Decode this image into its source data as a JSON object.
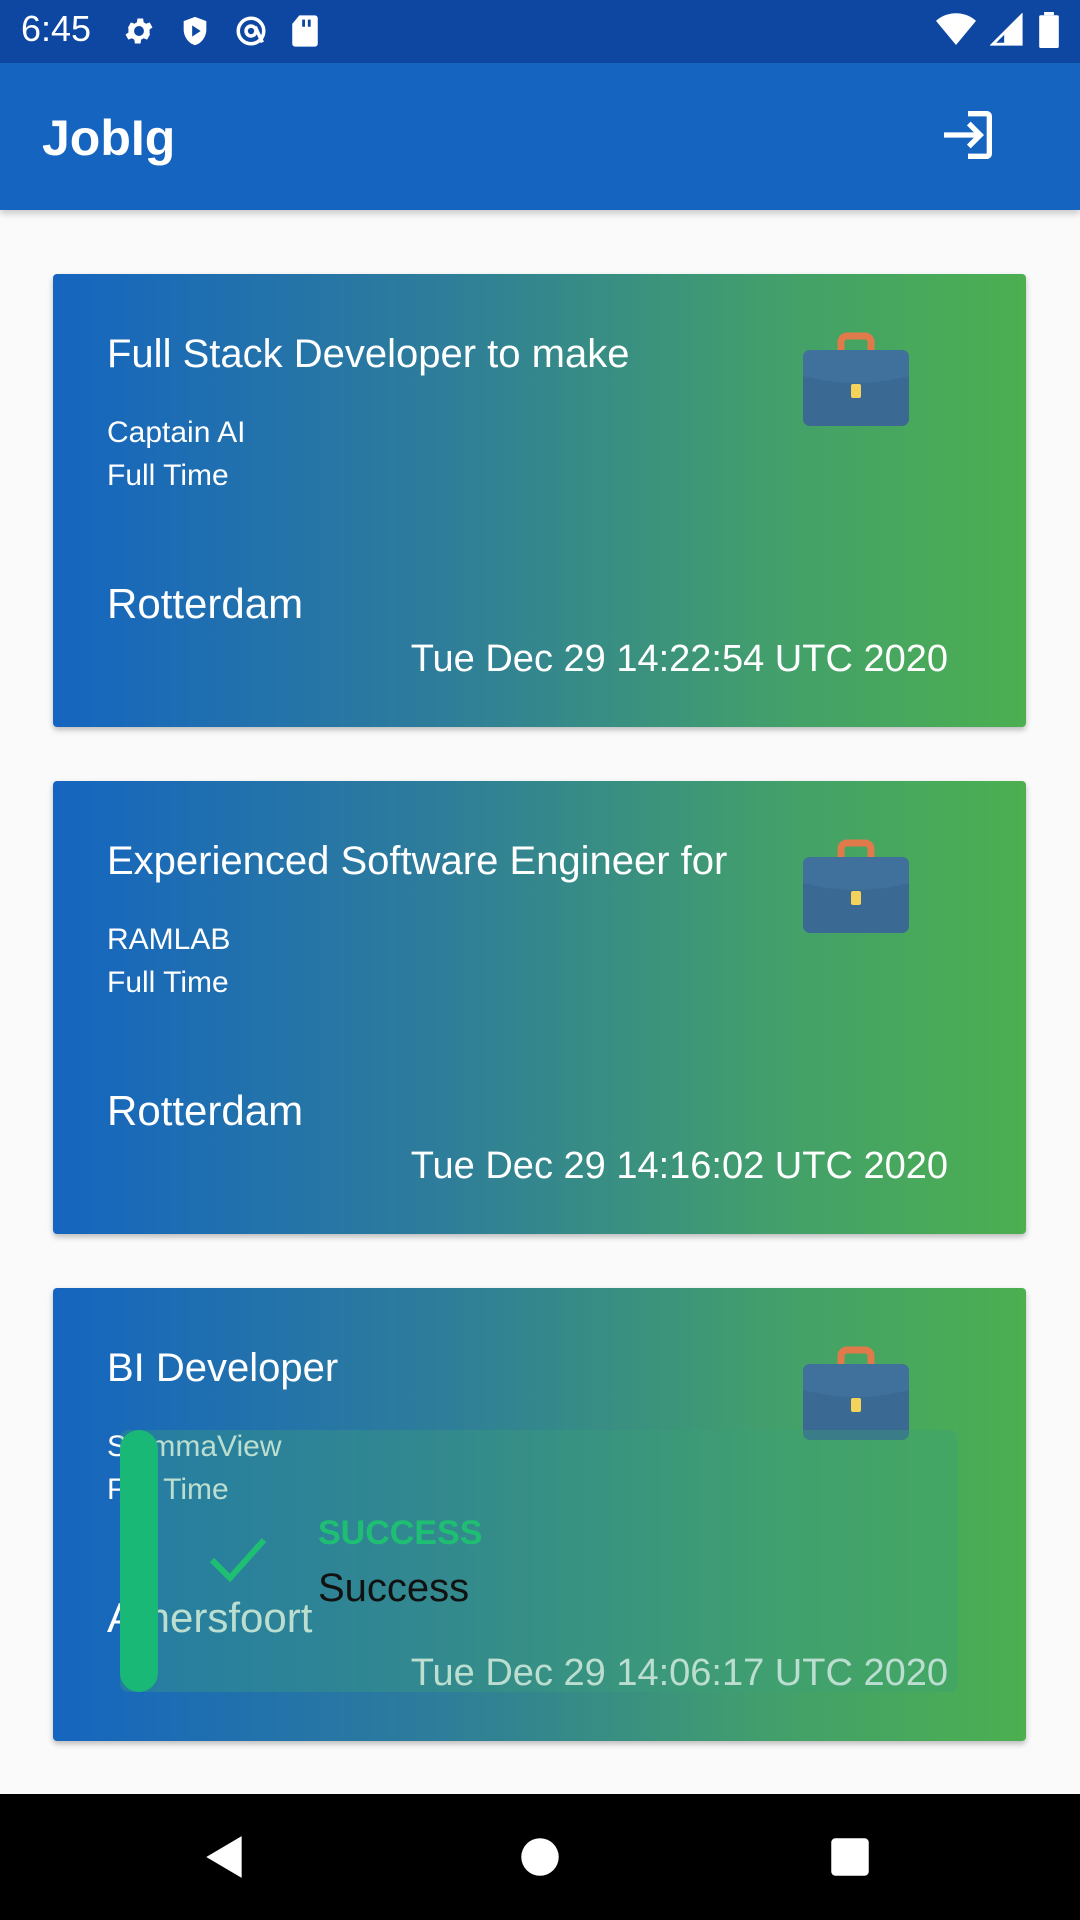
{
  "status_bar": {
    "time": "6:45"
  },
  "app_bar": {
    "title": "JobIg"
  },
  "jobs": [
    {
      "title": "Full Stack Developer to make",
      "company": "Captain AI",
      "type": "Full Time",
      "location": "Rotterdam",
      "date": "Tue Dec 29 14:22:54 UTC 2020"
    },
    {
      "title": "Experienced Software Engineer for",
      "company": "RAMLAB",
      "type": "Full Time",
      "location": "Rotterdam",
      "date": "Tue Dec 29 14:16:02 UTC 2020"
    },
    {
      "title": "BI Developer",
      "company": "SigmmaView",
      "type": "Full Time",
      "location": "Amersfoort",
      "date": "Tue Dec 29 14:06:17 UTC 2020"
    }
  ],
  "toast": {
    "title": "SUCCESS",
    "message": "Success"
  },
  "colors": {
    "status_bar": "#0d47a1",
    "app_bar": "#1565c0",
    "card_gradient_start": "#1565c0",
    "card_gradient_end": "#4caf50",
    "toast_accent": "#19b877"
  }
}
